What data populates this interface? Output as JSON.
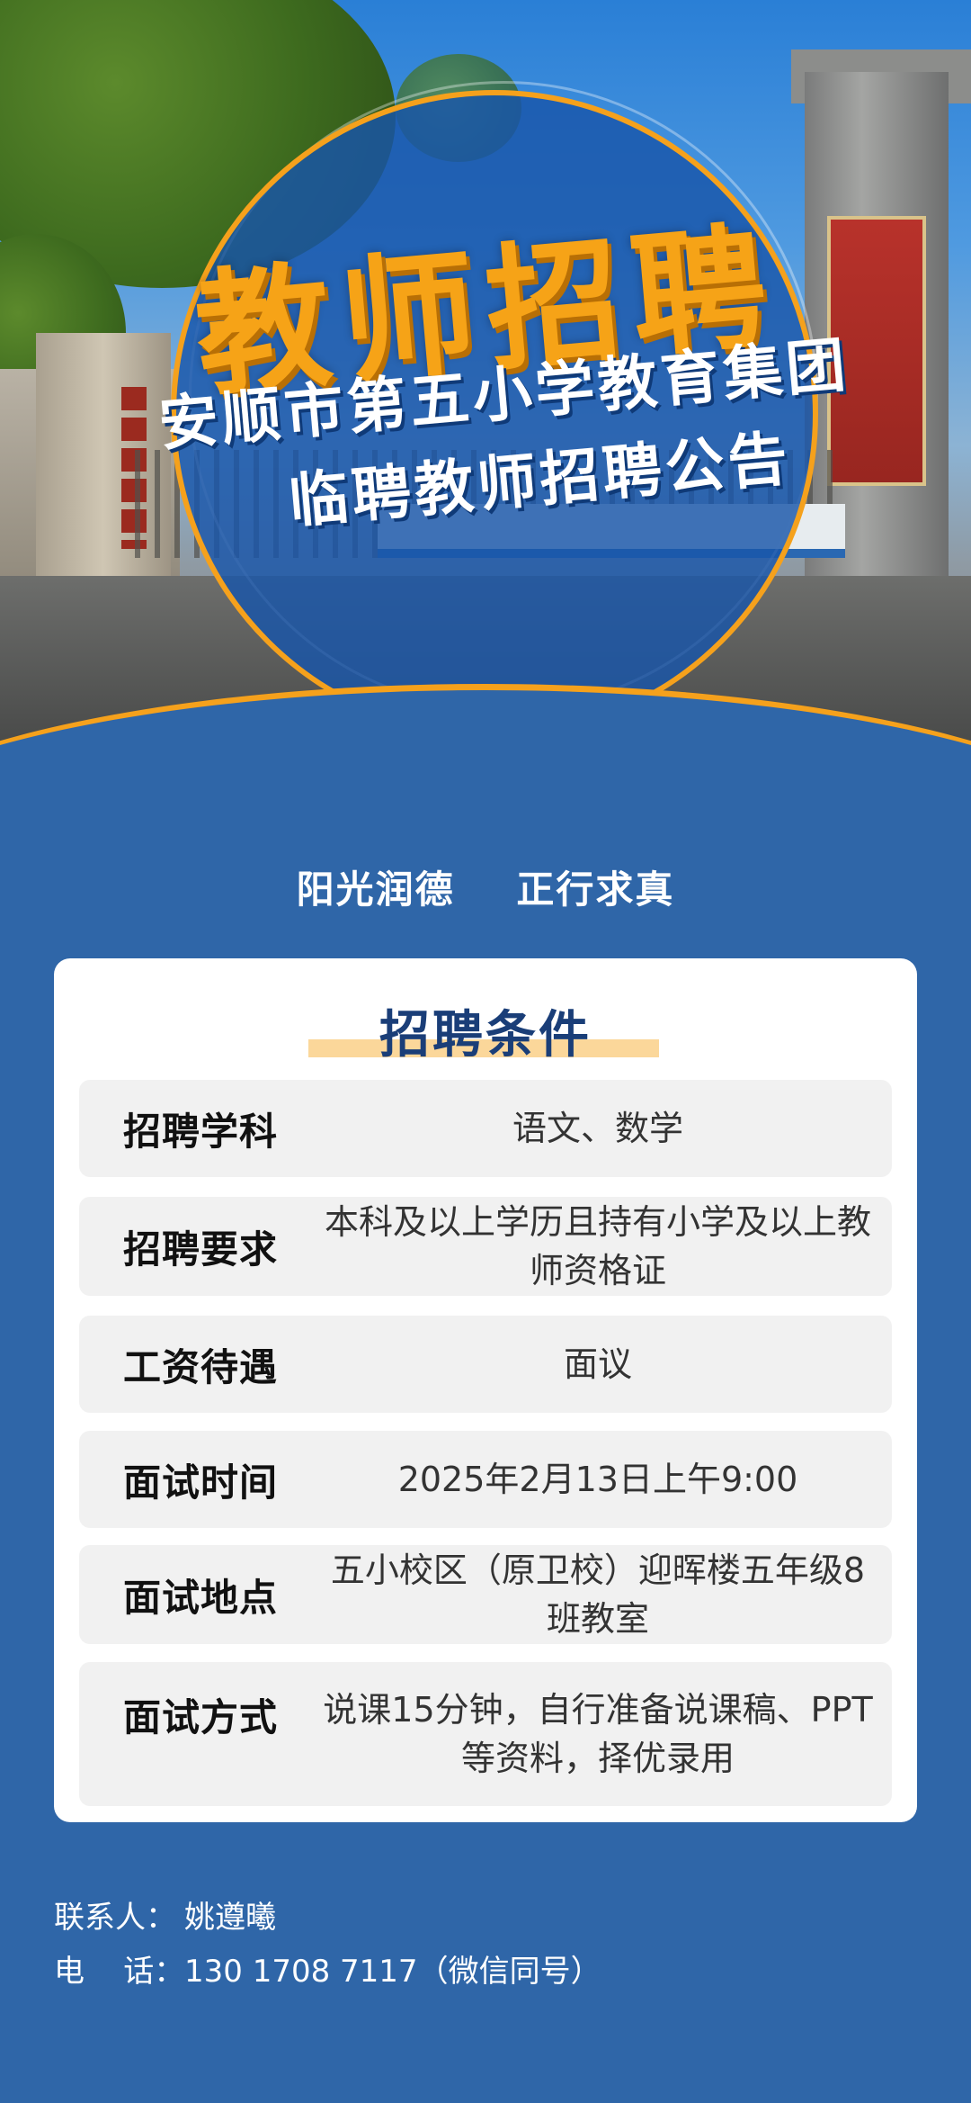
{
  "header": {
    "title": "教师招聘",
    "subtitle_line1": "安顺市第五小学教育集团",
    "subtitle_line2": "临聘教师招聘公告"
  },
  "slogan": {
    "part1": "阳光润德",
    "part2": "正行求真"
  },
  "card": {
    "title": "招聘条件",
    "rows": [
      {
        "label": "招聘学科",
        "value": "语文、数学"
      },
      {
        "label": "招聘要求",
        "value": "本科及以上学历且持有小学及以上教师资格证"
      },
      {
        "label": "工资待遇",
        "value": "面议"
      },
      {
        "label": "面试时间",
        "value": "2025年2月13日上午9:00"
      },
      {
        "label": "面试地点",
        "value": "五小校区（原卫校）迎晖楼五年级8班教室"
      },
      {
        "label": "面试方式",
        "value": "说课15分钟，自行准备说课稿、PPT等资料，择优录用"
      }
    ]
  },
  "contact": {
    "person_label": "联系人：",
    "person_name": "姚遵曦",
    "phone_label": "电    话：",
    "phone_value": "130 1708 7117（微信同号）"
  },
  "colors": {
    "background": "#2f66a8",
    "accent_orange": "#f6a317",
    "card_title": "#1a3e78",
    "row_bg": "#f1f1f1"
  }
}
